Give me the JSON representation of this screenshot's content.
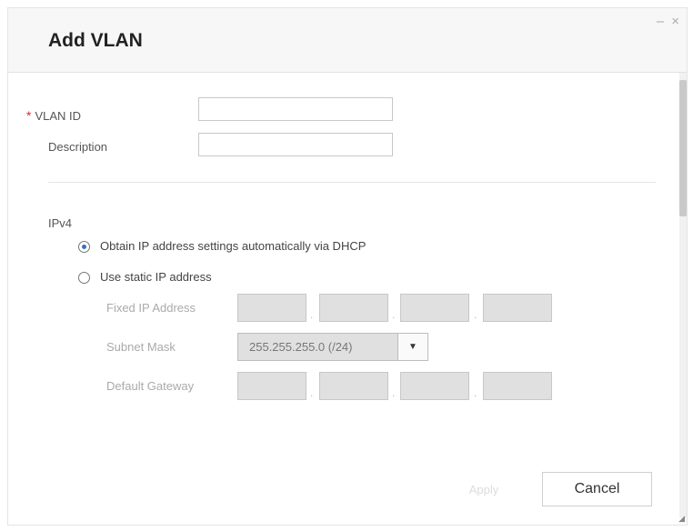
{
  "dialog": {
    "title": "Add VLAN",
    "window_buttons": "– ×"
  },
  "form": {
    "required_mark": "*",
    "vlan_id_label": "VLAN ID",
    "vlan_id_value": "",
    "description_label": "Description",
    "description_value": ""
  },
  "ipv4": {
    "section_label": "IPv4",
    "dhcp_option": "Obtain IP address settings automatically via DHCP",
    "static_option": "Use static IP address",
    "selected": "dhcp",
    "fixed_ip_label": "Fixed IP Address",
    "subnet_mask_label": "Subnet Mask",
    "subnet_mask_value": "255.255.255.0 (/24)",
    "default_gateway_label": "Default Gateway",
    "octet_separator": "."
  },
  "footer": {
    "apply_label": "Apply",
    "cancel_label": "Cancel"
  },
  "colors": {
    "required": "#d9292a",
    "radio_selected": "#3d6fbf",
    "disabled_field": "#e0e0e0"
  }
}
